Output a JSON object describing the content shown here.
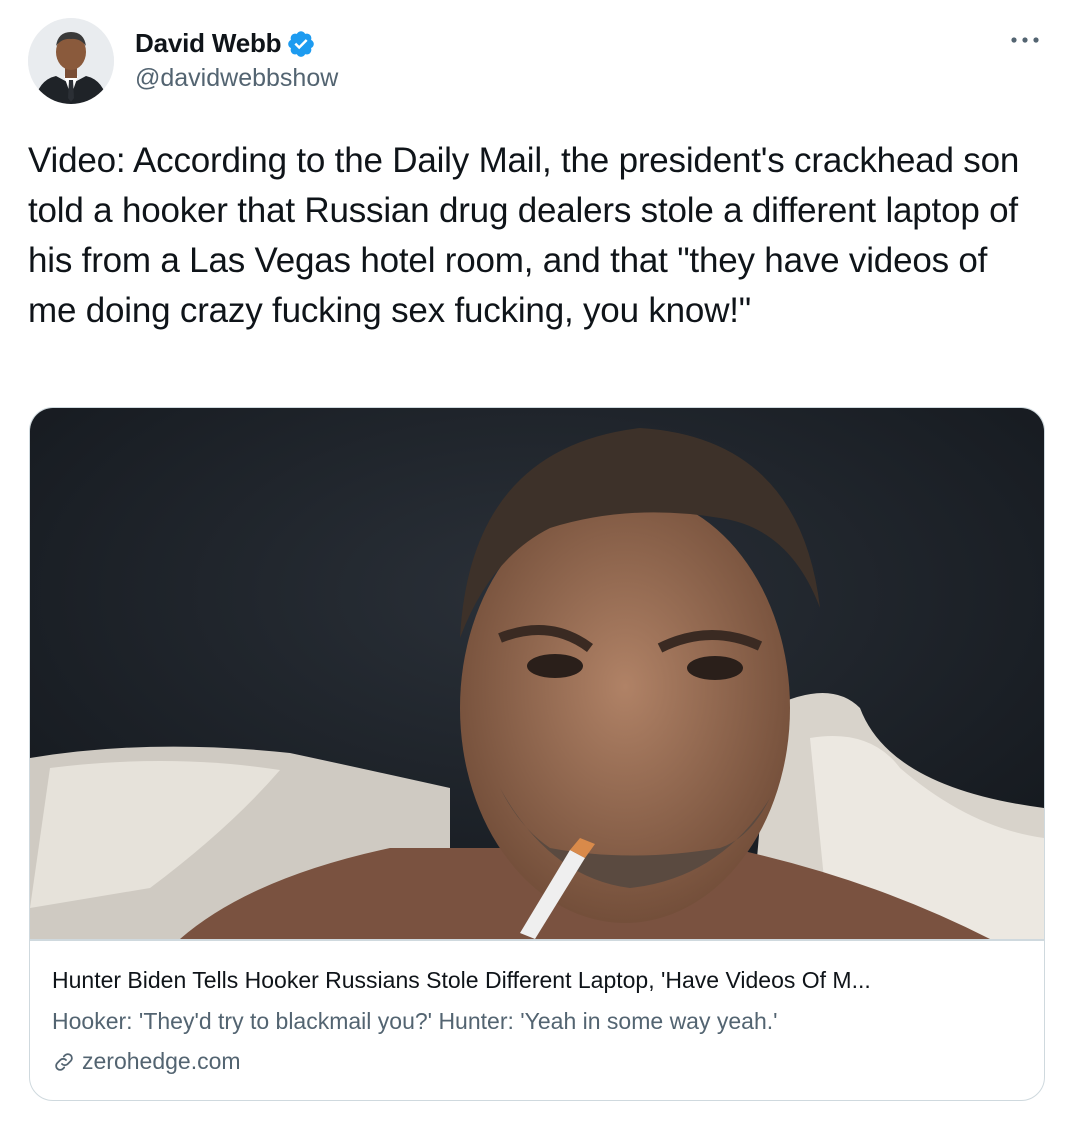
{
  "author": {
    "display_name": "David Webb",
    "handle": "@davidwebbshow",
    "verified": true
  },
  "tweet": {
    "text": "Video: According to the Daily Mail, the president's crackhead son told a hooker that Russian drug dealers stole a different laptop of his from a Las Vegas hotel room, and that \"they have videos of me doing crazy fucking sex fucking, you know!\""
  },
  "card": {
    "title": "Hunter Biden Tells Hooker Russians Stole Different Laptop, 'Have Videos Of M...",
    "description": "Hooker: 'They'd try to blackmail you?' Hunter: 'Yeah in some way yeah.'",
    "domain": "zerohedge.com"
  },
  "icons": {
    "verified": "verified-badge-icon",
    "more": "more-options-icon",
    "link": "link-icon"
  },
  "colors": {
    "verified_blue": "#1d9bf0",
    "secondary_text": "#536471",
    "border": "#cfd9de"
  }
}
